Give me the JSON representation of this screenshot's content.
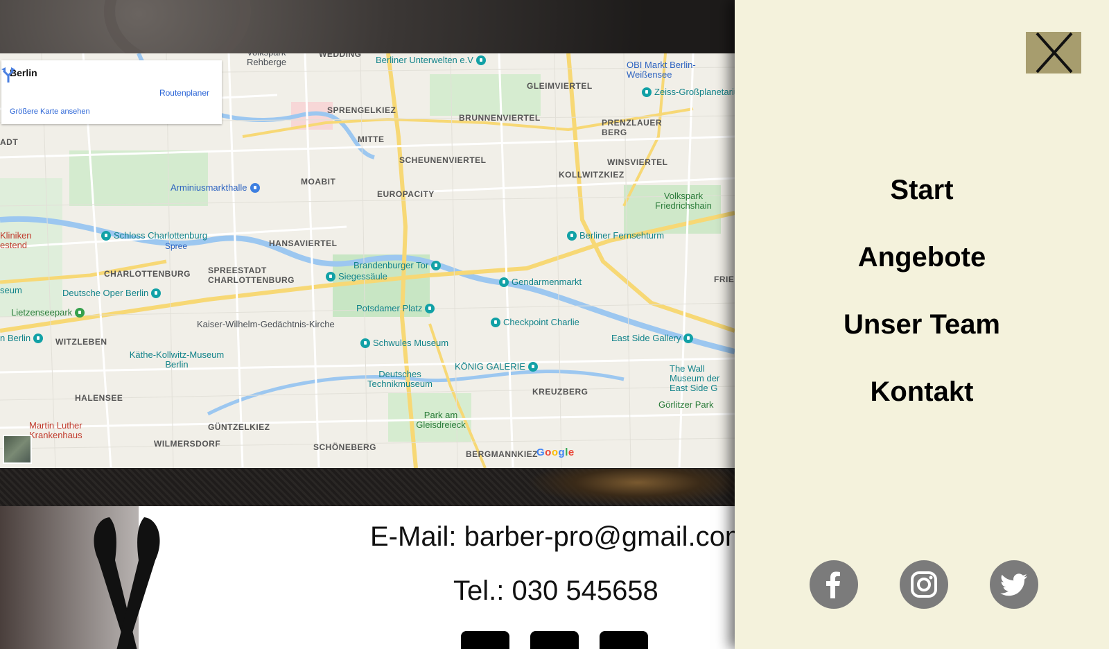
{
  "map": {
    "card": {
      "place": "Berlin",
      "route_label": "Routenplaner",
      "bigger_map_label": "Größere Karte ansehen"
    },
    "google_brand": "Google",
    "districts": [
      "WEDDING",
      "GLEIMVIERTEL",
      "SPRENGELKIEZ",
      "BRUNNENVIERTEL",
      "PRENZLAUER BERG",
      "MITTE",
      "SCHEUNENVIERTEL",
      "WINSVIERTEL",
      "KOLLWITZKIEZ",
      "MOABIT",
      "EUROPACITY",
      "HANSAVIERTEL",
      "CHARLOTTENBURG",
      "SPREESTADT CHARLOTTENBURG",
      "WITZLEBEN",
      "HALENSEE",
      "GÜNTZELKIEZ",
      "WILMERSDORF",
      "SCHÖNEBERG",
      "KREUZBERG",
      "BERGMANNKIEZ",
      "ADT",
      "FRIE"
    ],
    "pois": [
      "Berliner Unterwelten e.V",
      "OBI Markt Berlin-Weißensee",
      "Zeiss-Großplanetarium",
      "Arminiusmarkthalle",
      "Volkspark Friedrichshain",
      "Schloss Charlottenburg",
      "Spree",
      "Berliner Fernsehturm",
      "Brandenburger Tor",
      "Siegessäule",
      "Gendarmenmarkt",
      "Deutsche Oper Berlin",
      "Lietzenseepark",
      "Potsdamer Platz",
      "Kaiser-Wilhelm-Gedächtnis-Kirche",
      "Checkpoint Charlie",
      "East Side Gallery",
      "Schwules Museum",
      "Käthe-Kollwitz-Museum Berlin",
      "Deutsches Technikmuseum",
      "KÖNIG GALERIE",
      "The Wall Museum der East Side G",
      "Görlitzer Park",
      "Park am Gleisdreieck",
      "Martin Luther Krankenhaus",
      "Kliniken estend",
      "seum",
      "n Berlin",
      "Volkspark Rehberge"
    ]
  },
  "footer": {
    "email": "E-Mail: barber-pro@gmail.com",
    "phone": "Tel.: 030 545658"
  },
  "drawer": {
    "nav": [
      "Start",
      "Angebote",
      "Unser Team",
      "Kontakt"
    ],
    "social_icons": [
      "facebook-icon",
      "instagram-icon",
      "twitter-icon"
    ]
  },
  "colors": {
    "drawer_bg": "#f4f2dc",
    "close_button_bg": "#a79d6e",
    "social_circle": "#7b7b7b"
  }
}
